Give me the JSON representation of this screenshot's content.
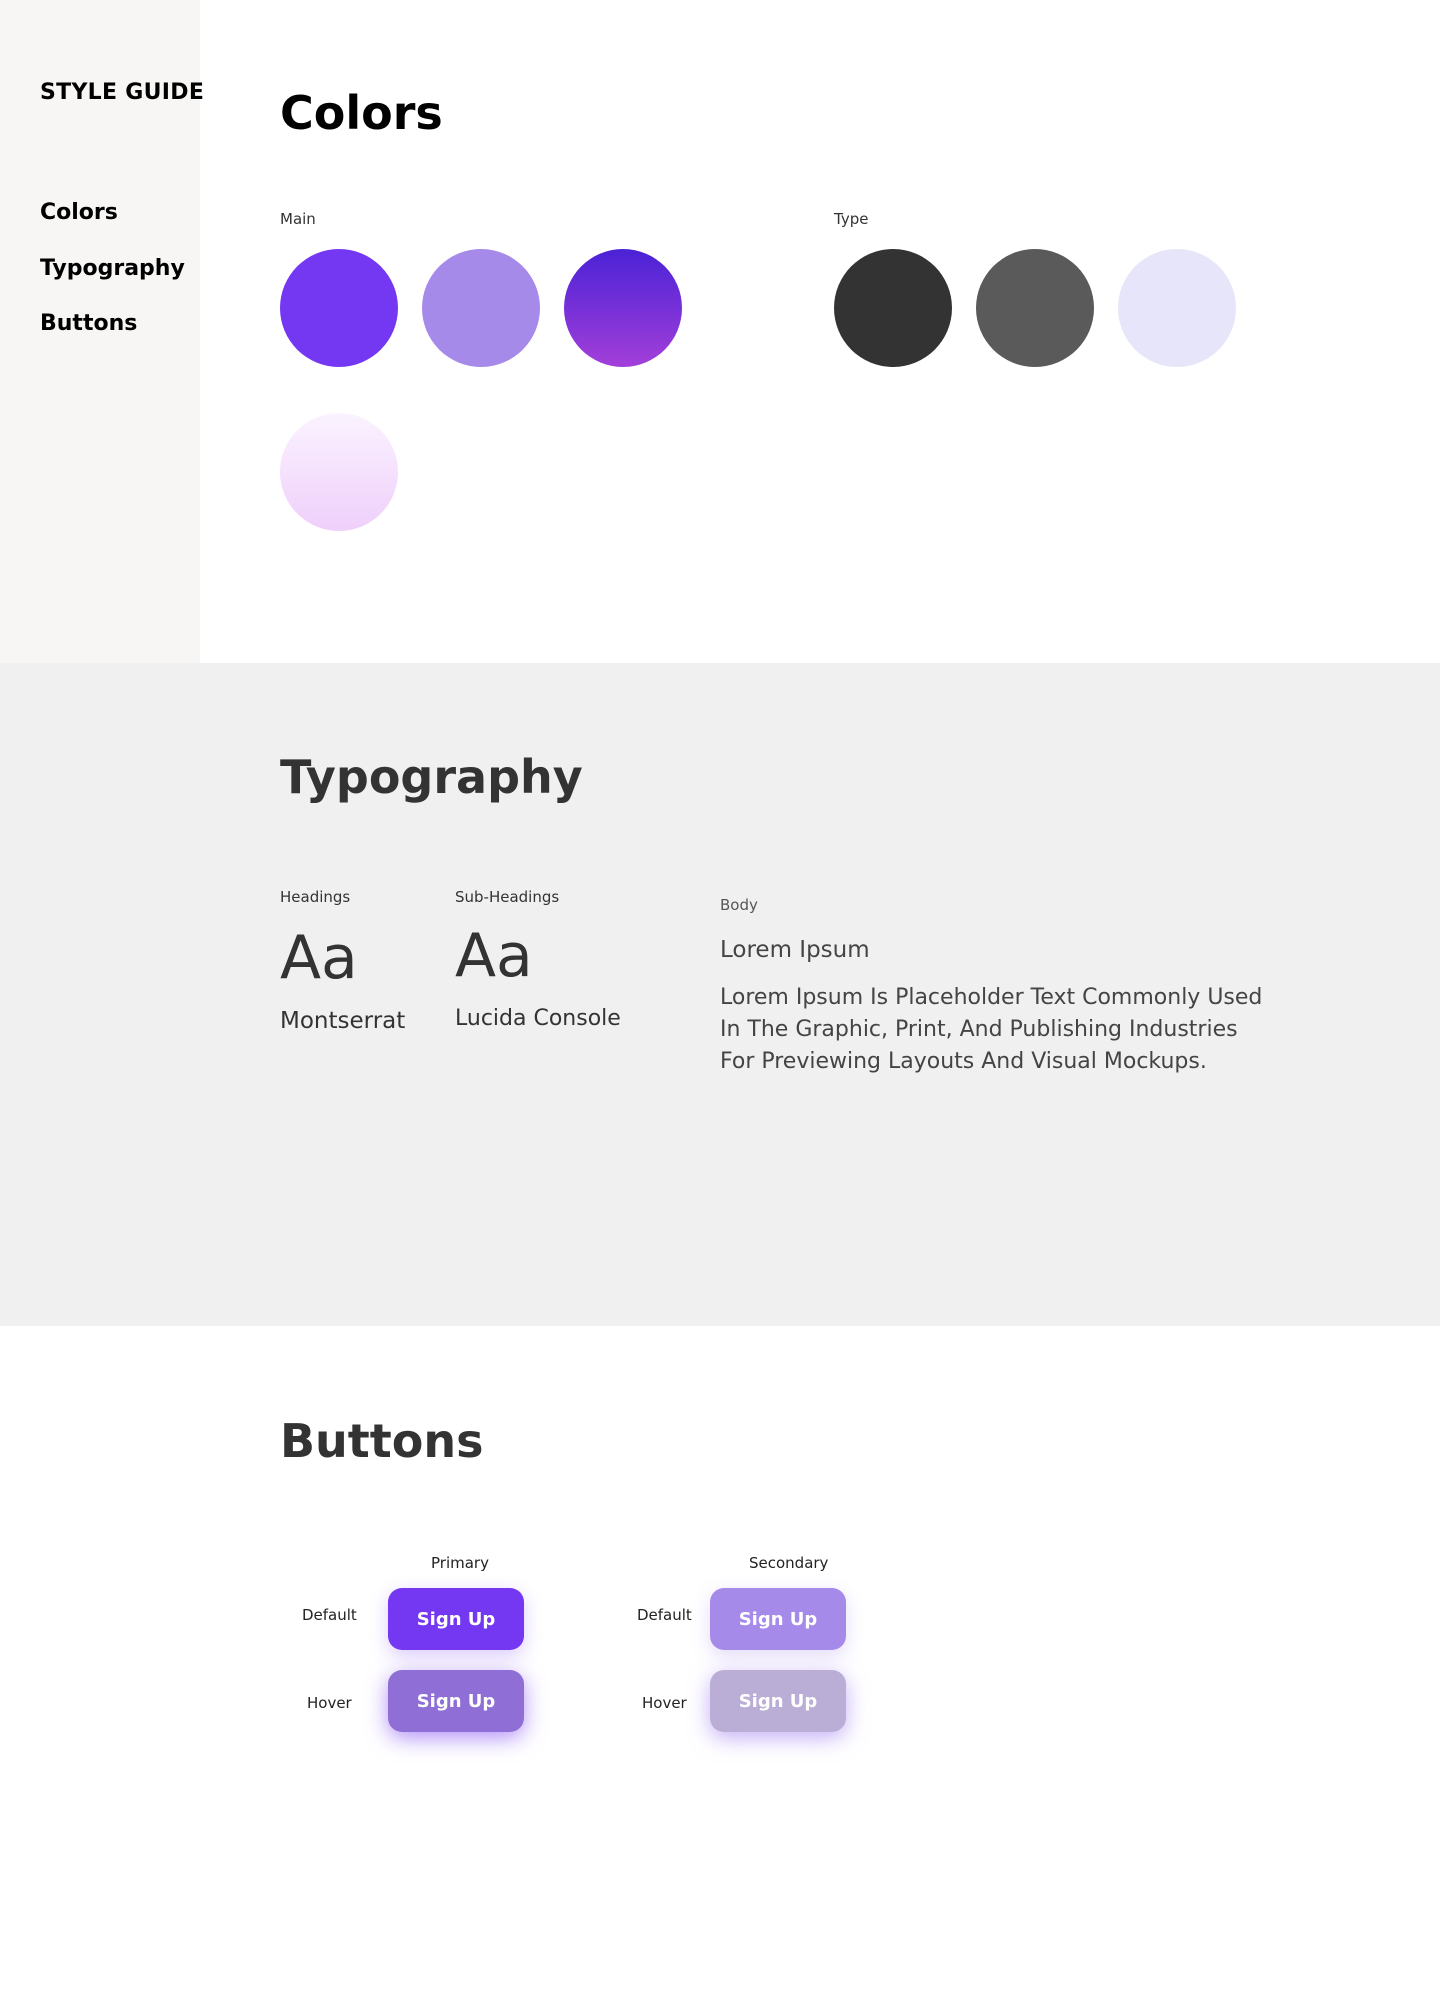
{
  "sidebar": {
    "brand": "STYLE GUIDE",
    "items": [
      {
        "label": "Colors"
      },
      {
        "label": "Typography"
      },
      {
        "label": "Buttons"
      }
    ]
  },
  "colors": {
    "title": "Colors",
    "main_label": "Main",
    "type_label": "Type",
    "main_swatches": [
      "#7538f2",
      "#a68aea",
      "linear-gradient(#4a22d6, #a33fd9)",
      "linear-gradient(#fbf3ff, #efcffb)"
    ],
    "type_swatches": [
      "#333333",
      "#5a5a5a",
      "#e7e5f9"
    ]
  },
  "typography": {
    "title": "Typography",
    "headings": {
      "label": "Headings",
      "sample": "Aa",
      "font": "Montserrat"
    },
    "subheadings": {
      "label": "Sub-Headings",
      "sample": "Aa",
      "font": "Lucida Console"
    },
    "body": {
      "label": "Body",
      "heading": "Lorem Ipsum",
      "lines": [
        "Lorem Ipsum Is Placeholder Text Commonly Used",
        "In The Graphic, Print, And Publishing Industries",
        "For Previewing Layouts And Visual Mockups."
      ]
    }
  },
  "buttons": {
    "title": "Buttons",
    "primary": {
      "label": "Primary",
      "default_state": "Default",
      "hover_state": "Hover",
      "default_text": "Sign Up",
      "hover_text": "Sign Up",
      "default_color": "#7538f2",
      "hover_color": "#8f6fd6"
    },
    "secondary": {
      "label": "Secondary",
      "default_state": "Default",
      "hover_state": "Hover",
      "default_text": "Sign Up",
      "hover_text": "Sign Up",
      "default_color": "#a68aea",
      "hover_color": "#bbaed6"
    }
  }
}
